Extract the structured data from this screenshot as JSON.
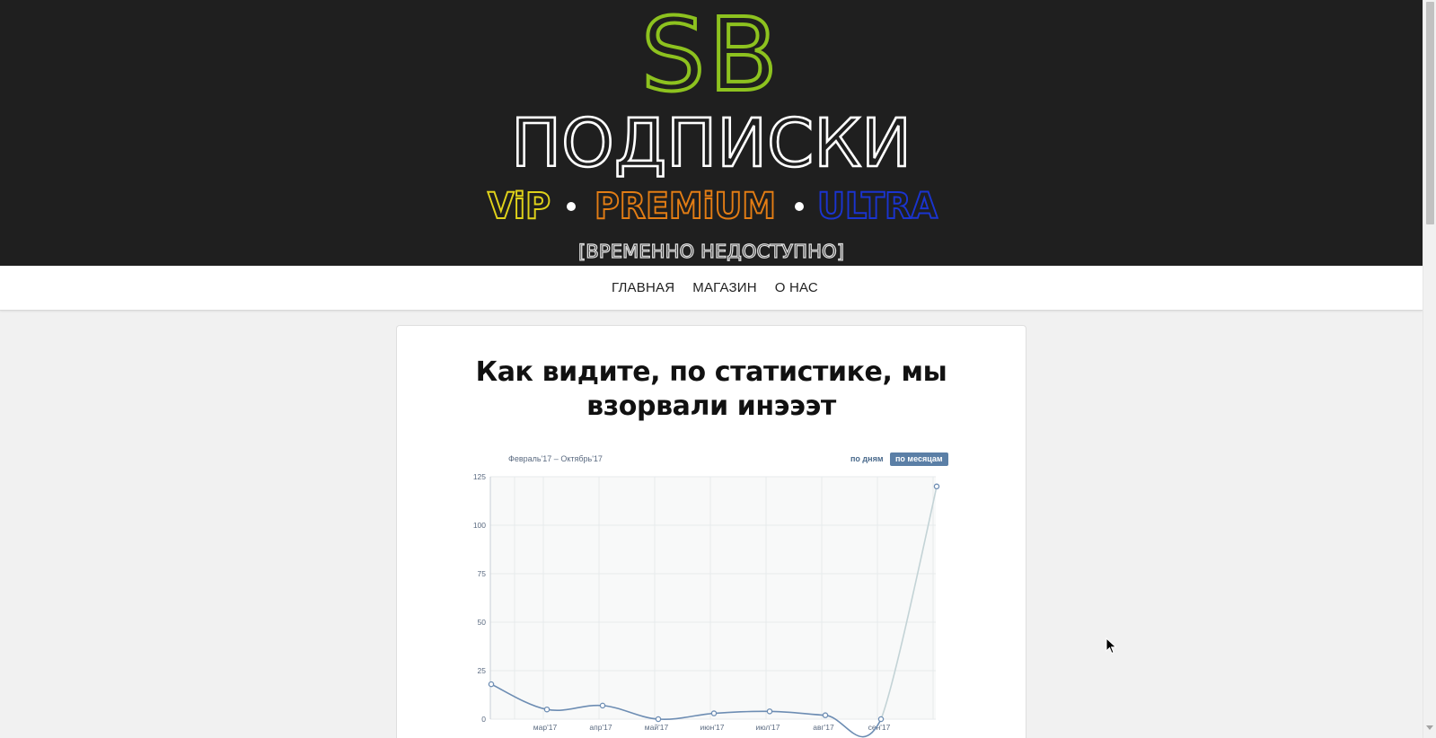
{
  "header": {
    "logo_top": "SB",
    "logo_main": "ПОДПИСКИ",
    "tier_vip": "ViP",
    "tier_premium": "PREMiUM",
    "tier_ultra": "ULTRA",
    "tier_separator": "•",
    "status": "[ВРЕМЕННО НЕДОСТУПНО]",
    "colors": {
      "background": "#1f1f1f",
      "sb_green": "#8dc21f",
      "vip_yellow": "#e0d21a",
      "premium_orange": "#e37d14",
      "ultra_blue": "#1a34d0"
    }
  },
  "nav": {
    "items": [
      {
        "label": "ГЛАВНАЯ"
      },
      {
        "label": "МАГАЗИН"
      },
      {
        "label": "О НАС"
      }
    ]
  },
  "main": {
    "title": "Как видите, по статистике, мы взорвали инэээт"
  },
  "chart_widget": {
    "range_label": "Февраль'17 – Октябрь'17",
    "toggle_days": "по дням",
    "toggle_months": "по месяцам",
    "active_toggle": "по месяцам"
  },
  "chart_data": {
    "type": "line",
    "categories": [
      "фев'17",
      "мар'17",
      "апр'17",
      "май'17",
      "июн'17",
      "июл'17",
      "авг'17",
      "сен'17",
      "окт'17"
    ],
    "x_tick_labels": [
      "мар'17",
      "апр'17",
      "май'17",
      "июн'17",
      "июл'17",
      "авг'17",
      "сен'17"
    ],
    "values": [
      18,
      5,
      7,
      0,
      3,
      4,
      2,
      0,
      120
    ],
    "y_ticks": [
      "0",
      "25",
      "50",
      "75",
      "100",
      "125"
    ],
    "ylim": [
      0,
      125
    ],
    "grid": true,
    "line_color": "#6d8db3",
    "last_segment_color": "#c3d3d6"
  }
}
